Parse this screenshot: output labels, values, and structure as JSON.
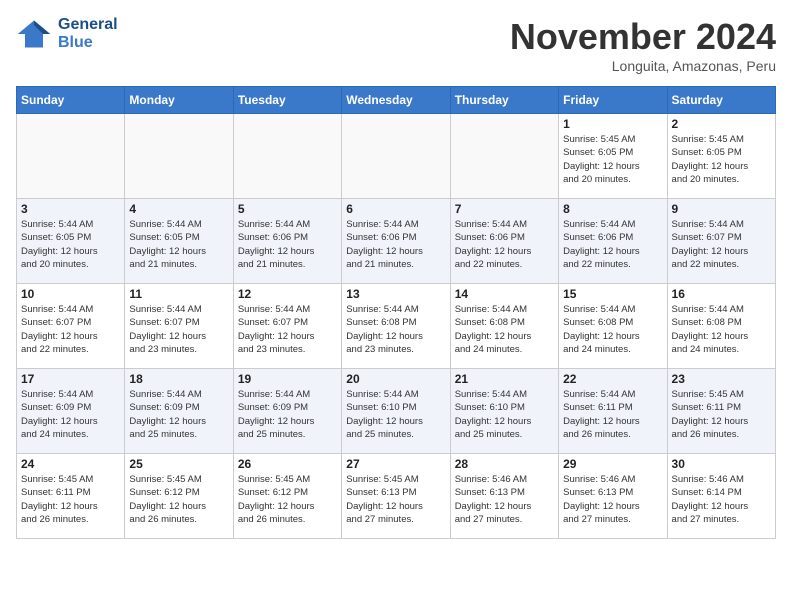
{
  "logo": {
    "text_line1": "General",
    "text_line2": "Blue"
  },
  "title": "November 2024",
  "subtitle": "Longuita, Amazonas, Peru",
  "weekdays": [
    "Sunday",
    "Monday",
    "Tuesday",
    "Wednesday",
    "Thursday",
    "Friday",
    "Saturday"
  ],
  "rows": [
    [
      {
        "day": "",
        "info": ""
      },
      {
        "day": "",
        "info": ""
      },
      {
        "day": "",
        "info": ""
      },
      {
        "day": "",
        "info": ""
      },
      {
        "day": "",
        "info": ""
      },
      {
        "day": "1",
        "info": "Sunrise: 5:45 AM\nSunset: 6:05 PM\nDaylight: 12 hours\nand 20 minutes."
      },
      {
        "day": "2",
        "info": "Sunrise: 5:45 AM\nSunset: 6:05 PM\nDaylight: 12 hours\nand 20 minutes."
      }
    ],
    [
      {
        "day": "3",
        "info": "Sunrise: 5:44 AM\nSunset: 6:05 PM\nDaylight: 12 hours\nand 20 minutes."
      },
      {
        "day": "4",
        "info": "Sunrise: 5:44 AM\nSunset: 6:05 PM\nDaylight: 12 hours\nand 21 minutes."
      },
      {
        "day": "5",
        "info": "Sunrise: 5:44 AM\nSunset: 6:06 PM\nDaylight: 12 hours\nand 21 minutes."
      },
      {
        "day": "6",
        "info": "Sunrise: 5:44 AM\nSunset: 6:06 PM\nDaylight: 12 hours\nand 21 minutes."
      },
      {
        "day": "7",
        "info": "Sunrise: 5:44 AM\nSunset: 6:06 PM\nDaylight: 12 hours\nand 22 minutes."
      },
      {
        "day": "8",
        "info": "Sunrise: 5:44 AM\nSunset: 6:06 PM\nDaylight: 12 hours\nand 22 minutes."
      },
      {
        "day": "9",
        "info": "Sunrise: 5:44 AM\nSunset: 6:07 PM\nDaylight: 12 hours\nand 22 minutes."
      }
    ],
    [
      {
        "day": "10",
        "info": "Sunrise: 5:44 AM\nSunset: 6:07 PM\nDaylight: 12 hours\nand 22 minutes."
      },
      {
        "day": "11",
        "info": "Sunrise: 5:44 AM\nSunset: 6:07 PM\nDaylight: 12 hours\nand 23 minutes."
      },
      {
        "day": "12",
        "info": "Sunrise: 5:44 AM\nSunset: 6:07 PM\nDaylight: 12 hours\nand 23 minutes."
      },
      {
        "day": "13",
        "info": "Sunrise: 5:44 AM\nSunset: 6:08 PM\nDaylight: 12 hours\nand 23 minutes."
      },
      {
        "day": "14",
        "info": "Sunrise: 5:44 AM\nSunset: 6:08 PM\nDaylight: 12 hours\nand 24 minutes."
      },
      {
        "day": "15",
        "info": "Sunrise: 5:44 AM\nSunset: 6:08 PM\nDaylight: 12 hours\nand 24 minutes."
      },
      {
        "day": "16",
        "info": "Sunrise: 5:44 AM\nSunset: 6:08 PM\nDaylight: 12 hours\nand 24 minutes."
      }
    ],
    [
      {
        "day": "17",
        "info": "Sunrise: 5:44 AM\nSunset: 6:09 PM\nDaylight: 12 hours\nand 24 minutes."
      },
      {
        "day": "18",
        "info": "Sunrise: 5:44 AM\nSunset: 6:09 PM\nDaylight: 12 hours\nand 25 minutes."
      },
      {
        "day": "19",
        "info": "Sunrise: 5:44 AM\nSunset: 6:09 PM\nDaylight: 12 hours\nand 25 minutes."
      },
      {
        "day": "20",
        "info": "Sunrise: 5:44 AM\nSunset: 6:10 PM\nDaylight: 12 hours\nand 25 minutes."
      },
      {
        "day": "21",
        "info": "Sunrise: 5:44 AM\nSunset: 6:10 PM\nDaylight: 12 hours\nand 25 minutes."
      },
      {
        "day": "22",
        "info": "Sunrise: 5:44 AM\nSunset: 6:11 PM\nDaylight: 12 hours\nand 26 minutes."
      },
      {
        "day": "23",
        "info": "Sunrise: 5:45 AM\nSunset: 6:11 PM\nDaylight: 12 hours\nand 26 minutes."
      }
    ],
    [
      {
        "day": "24",
        "info": "Sunrise: 5:45 AM\nSunset: 6:11 PM\nDaylight: 12 hours\nand 26 minutes."
      },
      {
        "day": "25",
        "info": "Sunrise: 5:45 AM\nSunset: 6:12 PM\nDaylight: 12 hours\nand 26 minutes."
      },
      {
        "day": "26",
        "info": "Sunrise: 5:45 AM\nSunset: 6:12 PM\nDaylight: 12 hours\nand 26 minutes."
      },
      {
        "day": "27",
        "info": "Sunrise: 5:45 AM\nSunset: 6:13 PM\nDaylight: 12 hours\nand 27 minutes."
      },
      {
        "day": "28",
        "info": "Sunrise: 5:46 AM\nSunset: 6:13 PM\nDaylight: 12 hours\nand 27 minutes."
      },
      {
        "day": "29",
        "info": "Sunrise: 5:46 AM\nSunset: 6:13 PM\nDaylight: 12 hours\nand 27 minutes."
      },
      {
        "day": "30",
        "info": "Sunrise: 5:46 AM\nSunset: 6:14 PM\nDaylight: 12 hours\nand 27 minutes."
      }
    ]
  ]
}
